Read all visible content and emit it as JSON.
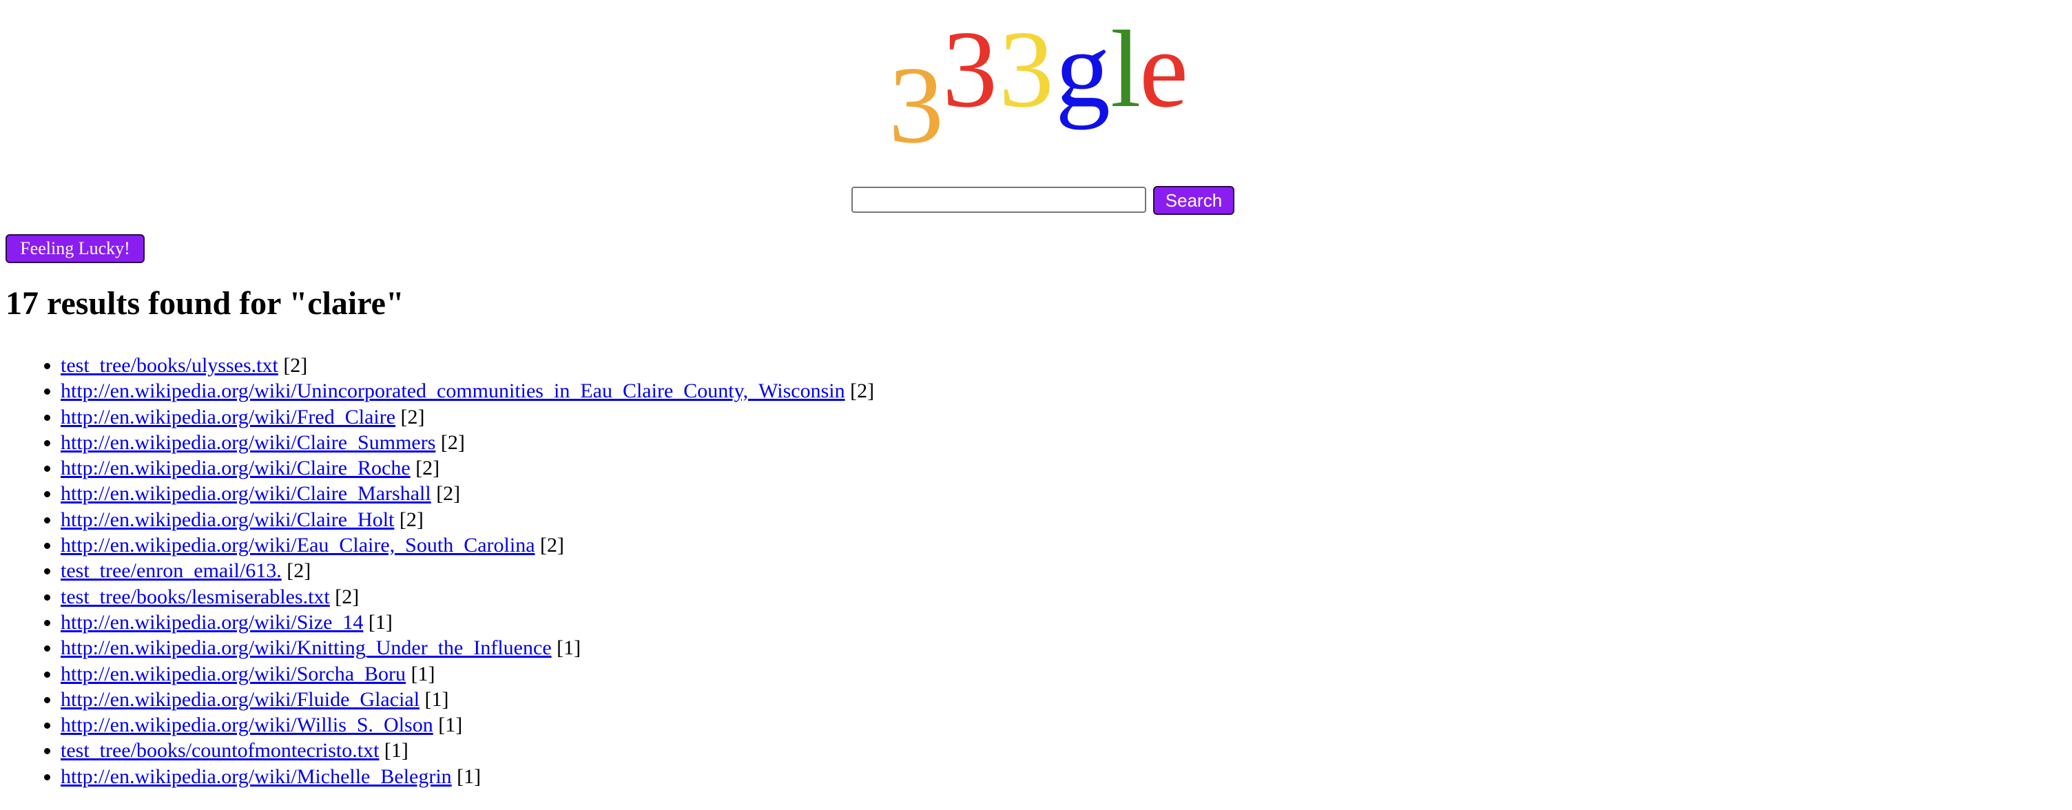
{
  "logo": {
    "letters": [
      {
        "char": "3",
        "color": "#f0a83a"
      },
      {
        "char": "3",
        "color": "#e8332a"
      },
      {
        "char": "3",
        "color": "#f5d63a"
      },
      {
        "char": "g",
        "color": "#1010e8"
      },
      {
        "char": "l",
        "color": "#3b8a23"
      },
      {
        "char": "e",
        "color": "#e8332a"
      }
    ]
  },
  "search": {
    "value": "",
    "placeholder": "",
    "button_label": "Search"
  },
  "lucky_button_label": "Feeling Lucky!",
  "results_heading": "17 results found for \"claire\"",
  "results": [
    {
      "link": "test_tree/books/ulysses.txt",
      "count": "[2]"
    },
    {
      "link": "http://en.wikipedia.org/wiki/Unincorporated_communities_in_Eau_Claire_County,_Wisconsin",
      "count": "[2]"
    },
    {
      "link": "http://en.wikipedia.org/wiki/Fred_Claire",
      "count": "[2]"
    },
    {
      "link": "http://en.wikipedia.org/wiki/Claire_Summers",
      "count": "[2]"
    },
    {
      "link": "http://en.wikipedia.org/wiki/Claire_Roche",
      "count": "[2]"
    },
    {
      "link": "http://en.wikipedia.org/wiki/Claire_Marshall",
      "count": "[2]"
    },
    {
      "link": "http://en.wikipedia.org/wiki/Claire_Holt",
      "count": "[2]"
    },
    {
      "link": "http://en.wikipedia.org/wiki/Eau_Claire,_South_Carolina",
      "count": "[2]"
    },
    {
      "link": "test_tree/enron_email/613.",
      "count": "[2]"
    },
    {
      "link": "test_tree/books/lesmiserables.txt",
      "count": "[2]"
    },
    {
      "link": "http://en.wikipedia.org/wiki/Size_14",
      "count": "[1]"
    },
    {
      "link": "http://en.wikipedia.org/wiki/Knitting_Under_the_Influence",
      "count": "[1]"
    },
    {
      "link": "http://en.wikipedia.org/wiki/Sorcha_Boru",
      "count": "[1]"
    },
    {
      "link": "http://en.wikipedia.org/wiki/Fluide_Glacial",
      "count": "[1]"
    },
    {
      "link": "http://en.wikipedia.org/wiki/Willis_S._Olson",
      "count": "[1]"
    },
    {
      "link": "test_tree/books/countofmontecristo.txt",
      "count": "[1]"
    },
    {
      "link": "http://en.wikipedia.org/wiki/Michelle_Belegrin",
      "count": "[1]"
    }
  ]
}
